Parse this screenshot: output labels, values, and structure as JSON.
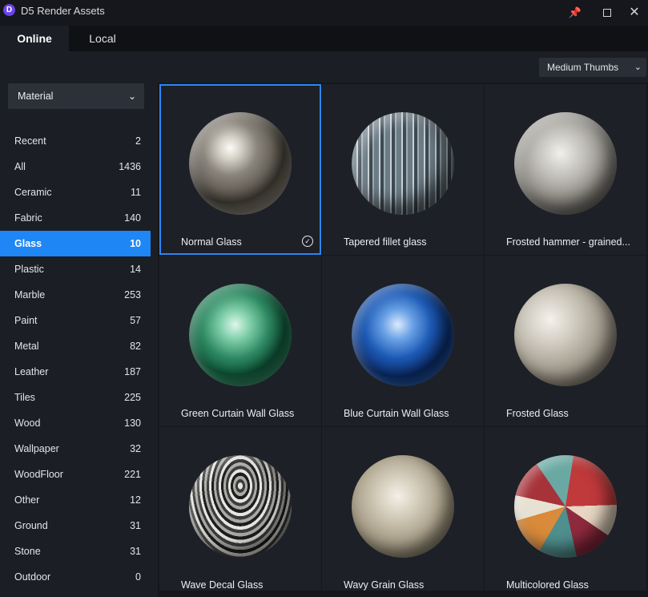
{
  "window": {
    "title": "D5 Render Assets",
    "logo_letter": "D"
  },
  "tabs": [
    {
      "label": "Online",
      "active": true
    },
    {
      "label": "Local",
      "active": false
    }
  ],
  "thumb_size": {
    "selected": "Medium Thumbs"
  },
  "category_filter": {
    "selected": "Material"
  },
  "categories": [
    {
      "label": "Recent",
      "count": "2"
    },
    {
      "label": "All",
      "count": "1436"
    },
    {
      "label": "Ceramic",
      "count": "11"
    },
    {
      "label": "Fabric",
      "count": "140"
    },
    {
      "label": "Glass",
      "count": "10",
      "active": true
    },
    {
      "label": "Plastic",
      "count": "14"
    },
    {
      "label": "Marble",
      "count": "253"
    },
    {
      "label": "Paint",
      "count": "57"
    },
    {
      "label": "Metal",
      "count": "82"
    },
    {
      "label": "Leather",
      "count": "187"
    },
    {
      "label": "Tiles",
      "count": "225"
    },
    {
      "label": "Wood",
      "count": "130"
    },
    {
      "label": "Wallpaper",
      "count": "32"
    },
    {
      "label": "WoodFloor",
      "count": "221"
    },
    {
      "label": "Other",
      "count": "12"
    },
    {
      "label": "Ground",
      "count": "31"
    },
    {
      "label": "Stone",
      "count": "31"
    },
    {
      "label": "Outdoor",
      "count": "0"
    }
  ],
  "assets": [
    {
      "name": "Normal Glass",
      "selected": true
    },
    {
      "name": "Tapered fillet glass"
    },
    {
      "name": "Frosted hammer - grained..."
    },
    {
      "name": "Green Curtain Wall Glass"
    },
    {
      "name": "Blue Curtain Wall Glass"
    },
    {
      "name": "Frosted Glass"
    },
    {
      "name": "Wave Decal Glass"
    },
    {
      "name": "Wavy Grain Glass"
    },
    {
      "name": "Multicolored Glass"
    }
  ],
  "colors": {
    "accent": "#1f86f5",
    "pin": "#3a8ef6",
    "logo": "#6a45e6"
  }
}
